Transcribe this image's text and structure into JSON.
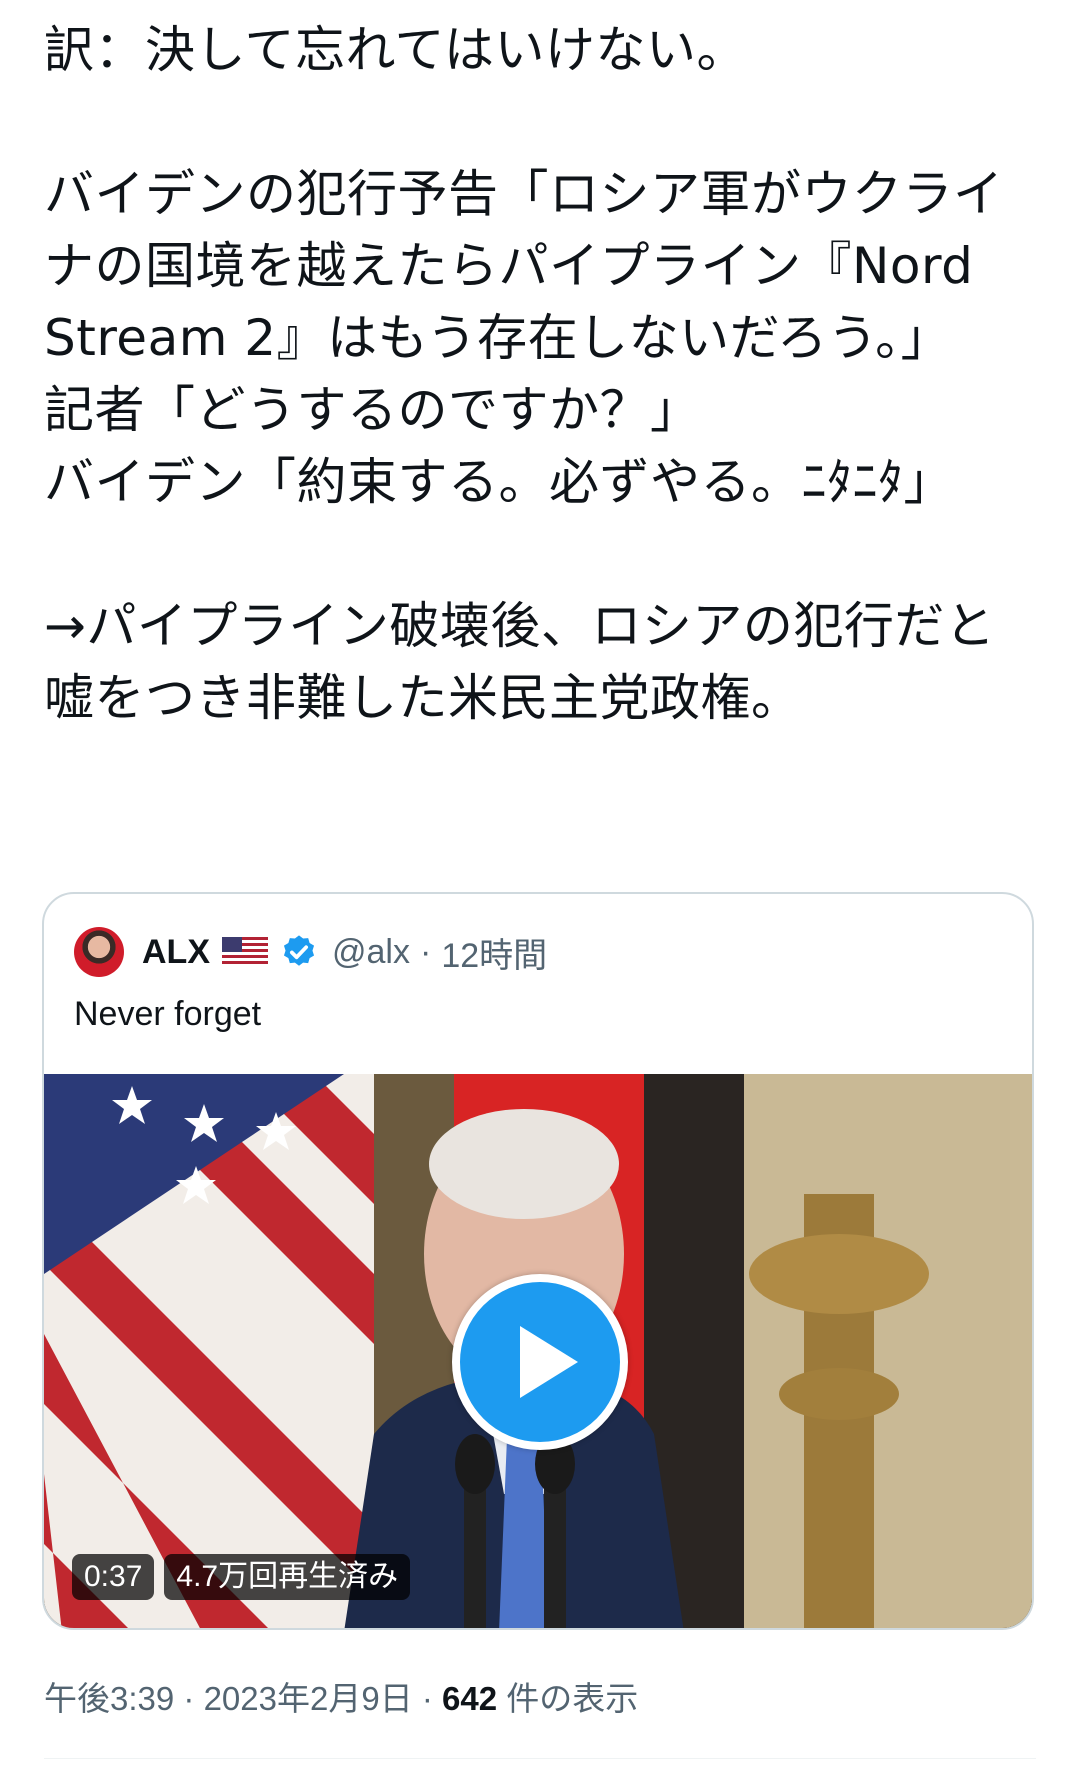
{
  "tweet": {
    "text": "訳：決して忘れてはいけない。\n\nバイデンの犯行予告「ロシア軍がウクライナの国境を越えたらパイプライン『Nord Stream 2』はもう存在しないだろう。」\n記者「どうするのですか？」\nバイデン「約束する。必ずやる。ﾆﾀﾆﾀ」\n\n→パイプライン破壊後、ロシアの犯行だと嘘をつき非難した米民主党政権。"
  },
  "quote": {
    "author_name": "ALX",
    "flag_icon": "us-flag-icon",
    "verified_icon": "verified-badge-icon",
    "handle": "@alx",
    "separator": "·",
    "time": "12時間",
    "text": "Never forget",
    "video": {
      "duration": "0:37",
      "views": "4.7万回再生済み",
      "play_icon": "play-icon"
    }
  },
  "meta": {
    "time": "午後3:39",
    "sep1": "·",
    "date": "2023年2月9日",
    "sep2": "·",
    "views_count": "642",
    "views_label": " 件の表示"
  },
  "colors": {
    "accent": "#1d9bf0",
    "muted_text": "#536471",
    "border": "#cfd9de"
  }
}
